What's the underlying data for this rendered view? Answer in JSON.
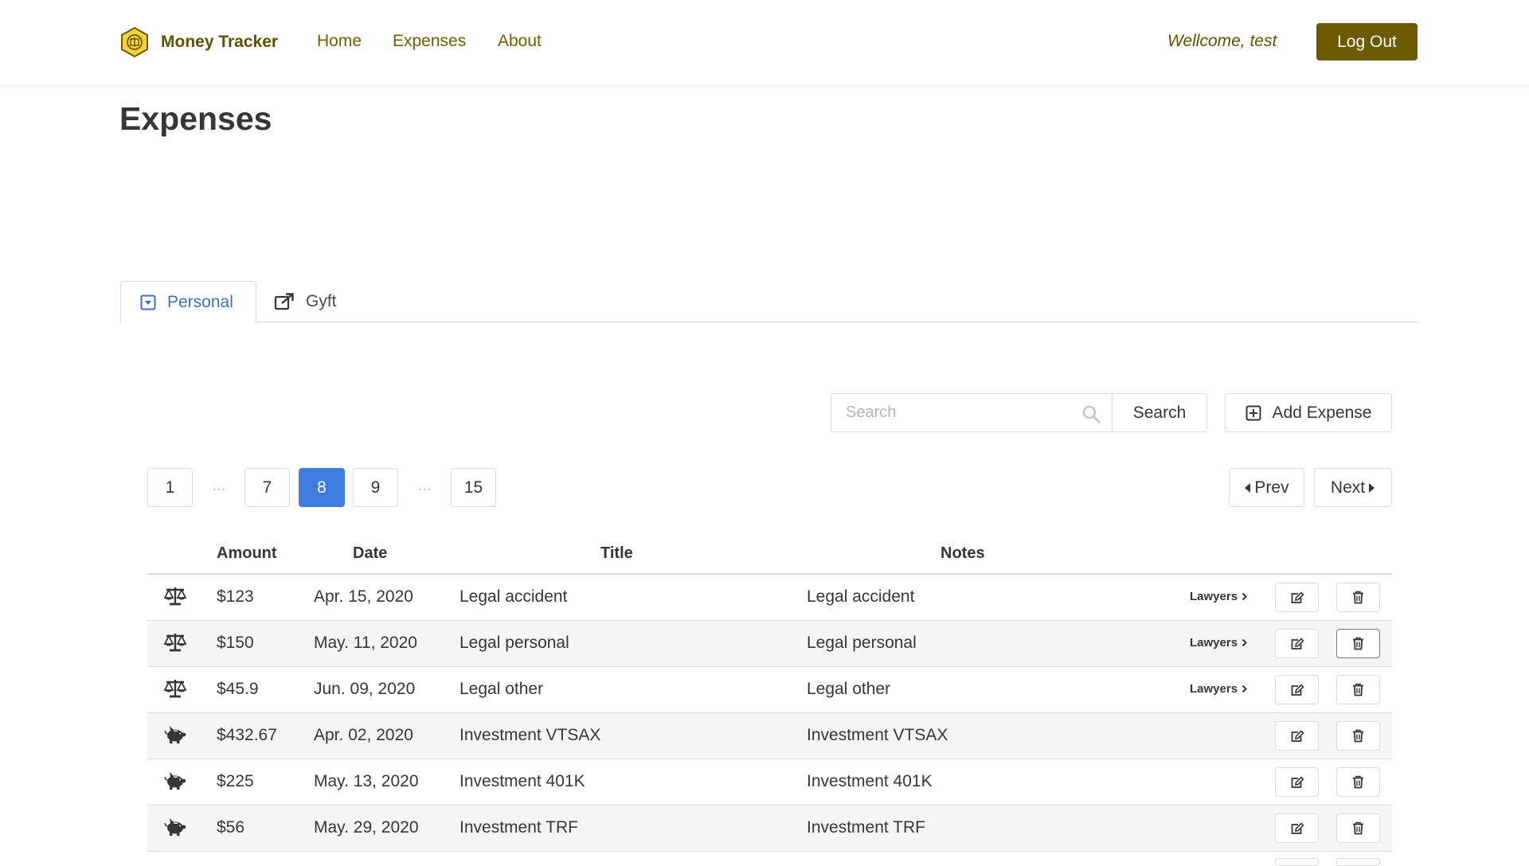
{
  "navbar": {
    "brand": "Money Tracker",
    "links": [
      {
        "label": "Home"
      },
      {
        "label": "Expenses"
      },
      {
        "label": "About"
      }
    ],
    "welcome": "Wellcome, test",
    "logout_label": "Log Out",
    "brand_color": "#6b5a00"
  },
  "page": {
    "title": "Expenses"
  },
  "tabs": [
    {
      "label": "Personal",
      "icon": "caret-square-down-icon",
      "active": true
    },
    {
      "label": "Gyft",
      "icon": "external-link-icon",
      "active": false
    }
  ],
  "search": {
    "placeholder": "Search",
    "value": "",
    "button_label": "Search"
  },
  "add_expense_label": "Add Expense",
  "pagination": {
    "pages": [
      "1",
      "7",
      "8",
      "9",
      "15"
    ],
    "ellipsis": "…",
    "current": "8",
    "prev_label": "Prev",
    "next_label": "Next",
    "accent": "#3e7ce0"
  },
  "table": {
    "headers": {
      "amount": "Amount",
      "date": "Date",
      "title": "Title",
      "notes": "Notes"
    },
    "rows": [
      {
        "icon": "balance-scale-icon",
        "amount": "$123",
        "date": "Apr. 15, 2020",
        "title": "Legal accident",
        "notes": "Legal accident",
        "link": "Lawyers"
      },
      {
        "icon": "balance-scale-icon",
        "amount": "$150",
        "date": "May. 11, 2020",
        "title": "Legal personal",
        "notes": "Legal personal",
        "link": "Lawyers"
      },
      {
        "icon": "balance-scale-icon",
        "amount": "$45.9",
        "date": "Jun. 09, 2020",
        "title": "Legal other",
        "notes": "Legal other",
        "link": "Lawyers"
      },
      {
        "icon": "piggy-bank-icon",
        "amount": "$432.67",
        "date": "Apr. 02, 2020",
        "title": "Investment VTSAX",
        "notes": "Investment VTSAX",
        "link": ""
      },
      {
        "icon": "piggy-bank-icon",
        "amount": "$225",
        "date": "May. 13, 2020",
        "title": "Investment 401K",
        "notes": "Investment 401K",
        "link": ""
      },
      {
        "icon": "piggy-bank-icon",
        "amount": "$56",
        "date": "May. 29, 2020",
        "title": "Investment TRF",
        "notes": "Investment TRF",
        "link": ""
      }
    ]
  }
}
